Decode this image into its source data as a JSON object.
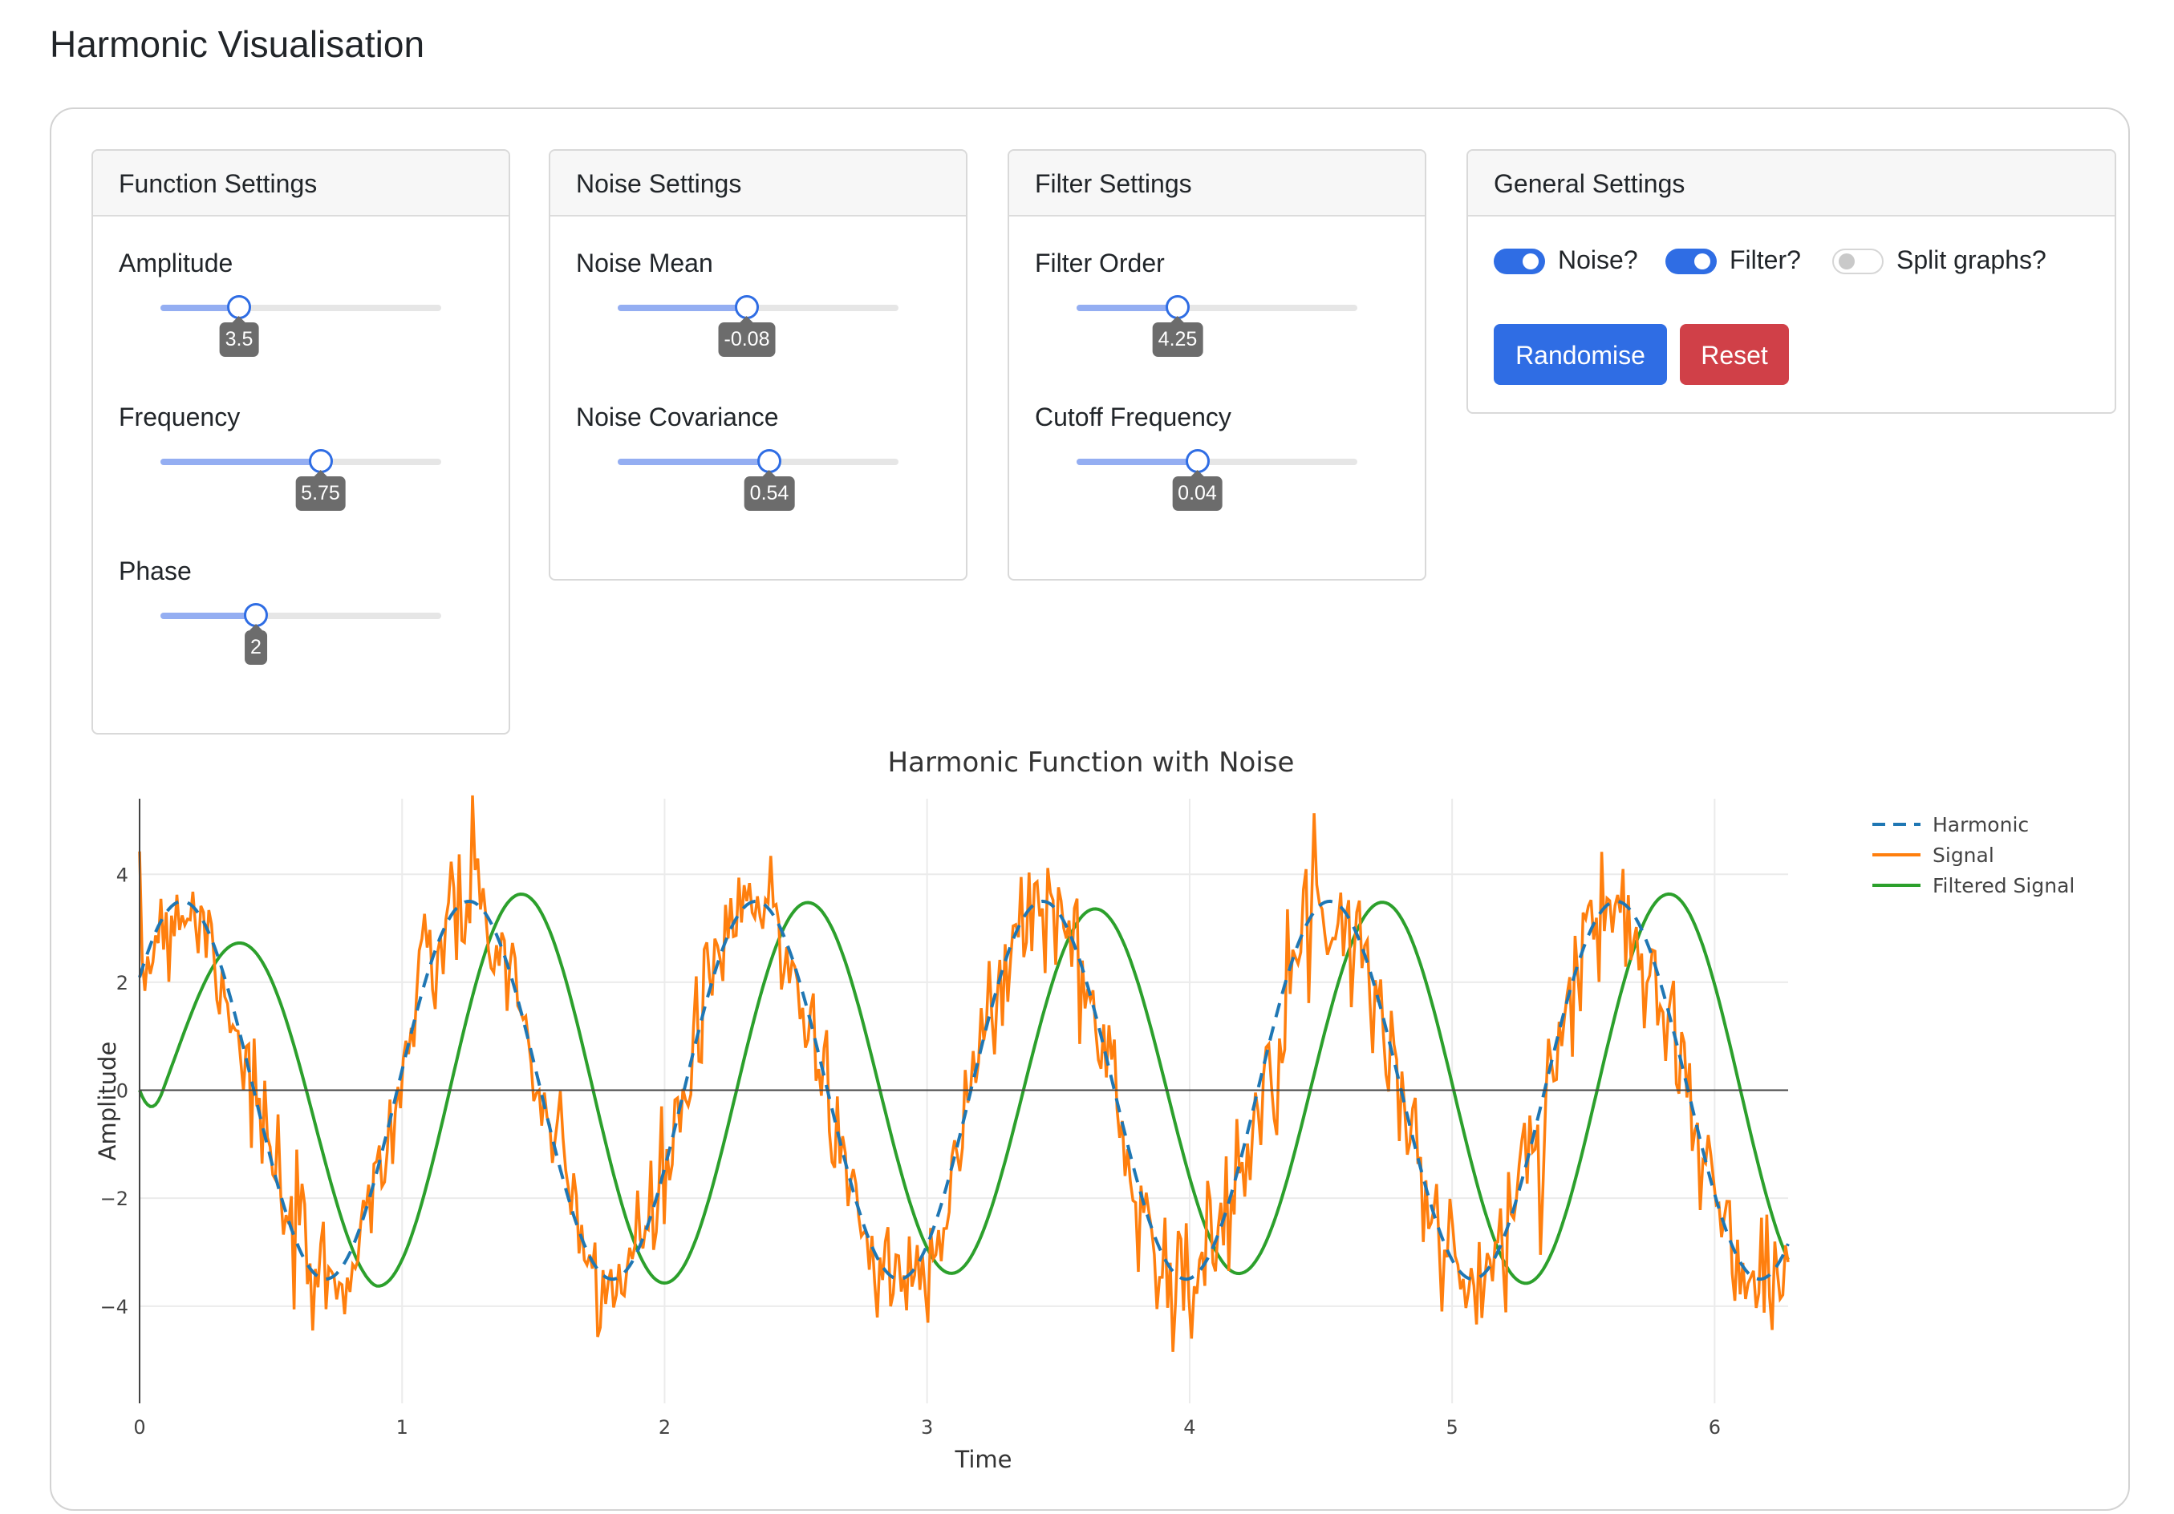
{
  "page": {
    "title": "Harmonic Visualisation"
  },
  "function_settings": {
    "header": "Function Settings",
    "sliders": [
      {
        "label": "Amplitude",
        "value_label": "3.5",
        "fraction": 0.28
      },
      {
        "label": "Frequency",
        "value_label": "5.75",
        "fraction": 0.57
      },
      {
        "label": "Phase",
        "value_label": "2",
        "fraction": 0.34
      }
    ]
  },
  "noise_settings": {
    "header": "Noise Settings",
    "sliders": [
      {
        "label": "Noise Mean",
        "value_label": "-0.08",
        "fraction": 0.46
      },
      {
        "label": "Noise Covariance",
        "value_label": "0.54",
        "fraction": 0.54
      }
    ]
  },
  "filter_settings": {
    "header": "Filter Settings",
    "sliders": [
      {
        "label": "Filter Order",
        "value_label": "4.25",
        "fraction": 0.36
      },
      {
        "label": "Cutoff Frequency",
        "value_label": "0.04",
        "fraction": 0.43
      }
    ]
  },
  "general_settings": {
    "header": "General Settings",
    "toggles": [
      {
        "label": "Noise?",
        "on": true
      },
      {
        "label": "Filter?",
        "on": true
      },
      {
        "label": "Split graphs?",
        "on": false
      }
    ],
    "randomise_label": "Randomise",
    "reset_label": "Reset"
  },
  "chart_data": {
    "type": "line",
    "title": "Harmonic Function with Noise",
    "xlabel": "Time",
    "ylabel": "Amplitude",
    "xlim": [
      0,
      6.28
    ],
    "ylim": [
      -5.8,
      5.4
    ],
    "x_ticks": [
      0,
      1,
      2,
      3,
      4,
      5,
      6
    ],
    "x_tick_labels": [
      "0",
      "1",
      "2",
      "3",
      "4",
      "5",
      "6"
    ],
    "y_ticks": [
      -4,
      -2,
      0,
      2,
      4
    ],
    "y_tick_labels": [
      "−4",
      "−2",
      "0",
      "2",
      "4"
    ],
    "grid": true,
    "legend_position": "top-right",
    "series": [
      {
        "name": "Harmonic",
        "color": "#1f77b4",
        "dash": "dashed",
        "amplitude": 3.5,
        "frequency": 5.75,
        "phase": 2
      },
      {
        "name": "Signal",
        "color": "#ff7f0e",
        "dash": "solid",
        "noise_mean": -0.08,
        "noise_covariance": 0.54
      },
      {
        "name": "Filtered Signal",
        "color": "#2ca02c",
        "dash": "solid"
      }
    ]
  }
}
